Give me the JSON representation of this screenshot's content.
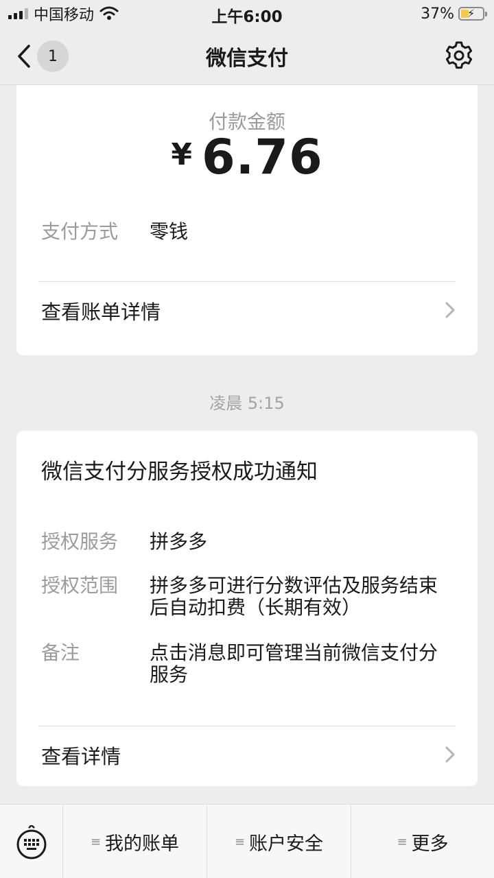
{
  "status_bar": {
    "carrier": "中国移动",
    "time": "上午6:00",
    "battery_percent": "37%",
    "battery_level": 0.37,
    "icons": [
      "signal-icon",
      "wifi-icon",
      "battery-charging-icon"
    ]
  },
  "nav": {
    "back_icon": "chevron-left-icon",
    "unread_count": "1",
    "title": "微信支付",
    "settings_icon": "gear-icon"
  },
  "payment_card": {
    "amount_label": "付款金额",
    "currency": "¥",
    "amount": "6.76",
    "method_label": "支付方式",
    "method_value": "零钱",
    "details_link": "查看账单详情"
  },
  "timestamp": "凌晨 5:15",
  "notice_card": {
    "title": "微信支付分服务授权成功通知",
    "rows": [
      {
        "key": "授权服务",
        "value": "拼多多"
      },
      {
        "key": "授权范围",
        "value": "拼多多可进行分数评估及服务结束后自动扣费（长期有效）"
      },
      {
        "key": "备注",
        "value": "点击消息即可管理当前微信支付分服务"
      }
    ],
    "details_link": "查看详情"
  },
  "bottom_menu": {
    "keyboard_icon": "keyboard-icon",
    "items": [
      "我的账单",
      "账户安全",
      "更多"
    ]
  },
  "colors": {
    "background": "#ededed",
    "card": "#ffffff",
    "secondary_text": "#9b9b9b",
    "battery": "#f6c84b"
  }
}
